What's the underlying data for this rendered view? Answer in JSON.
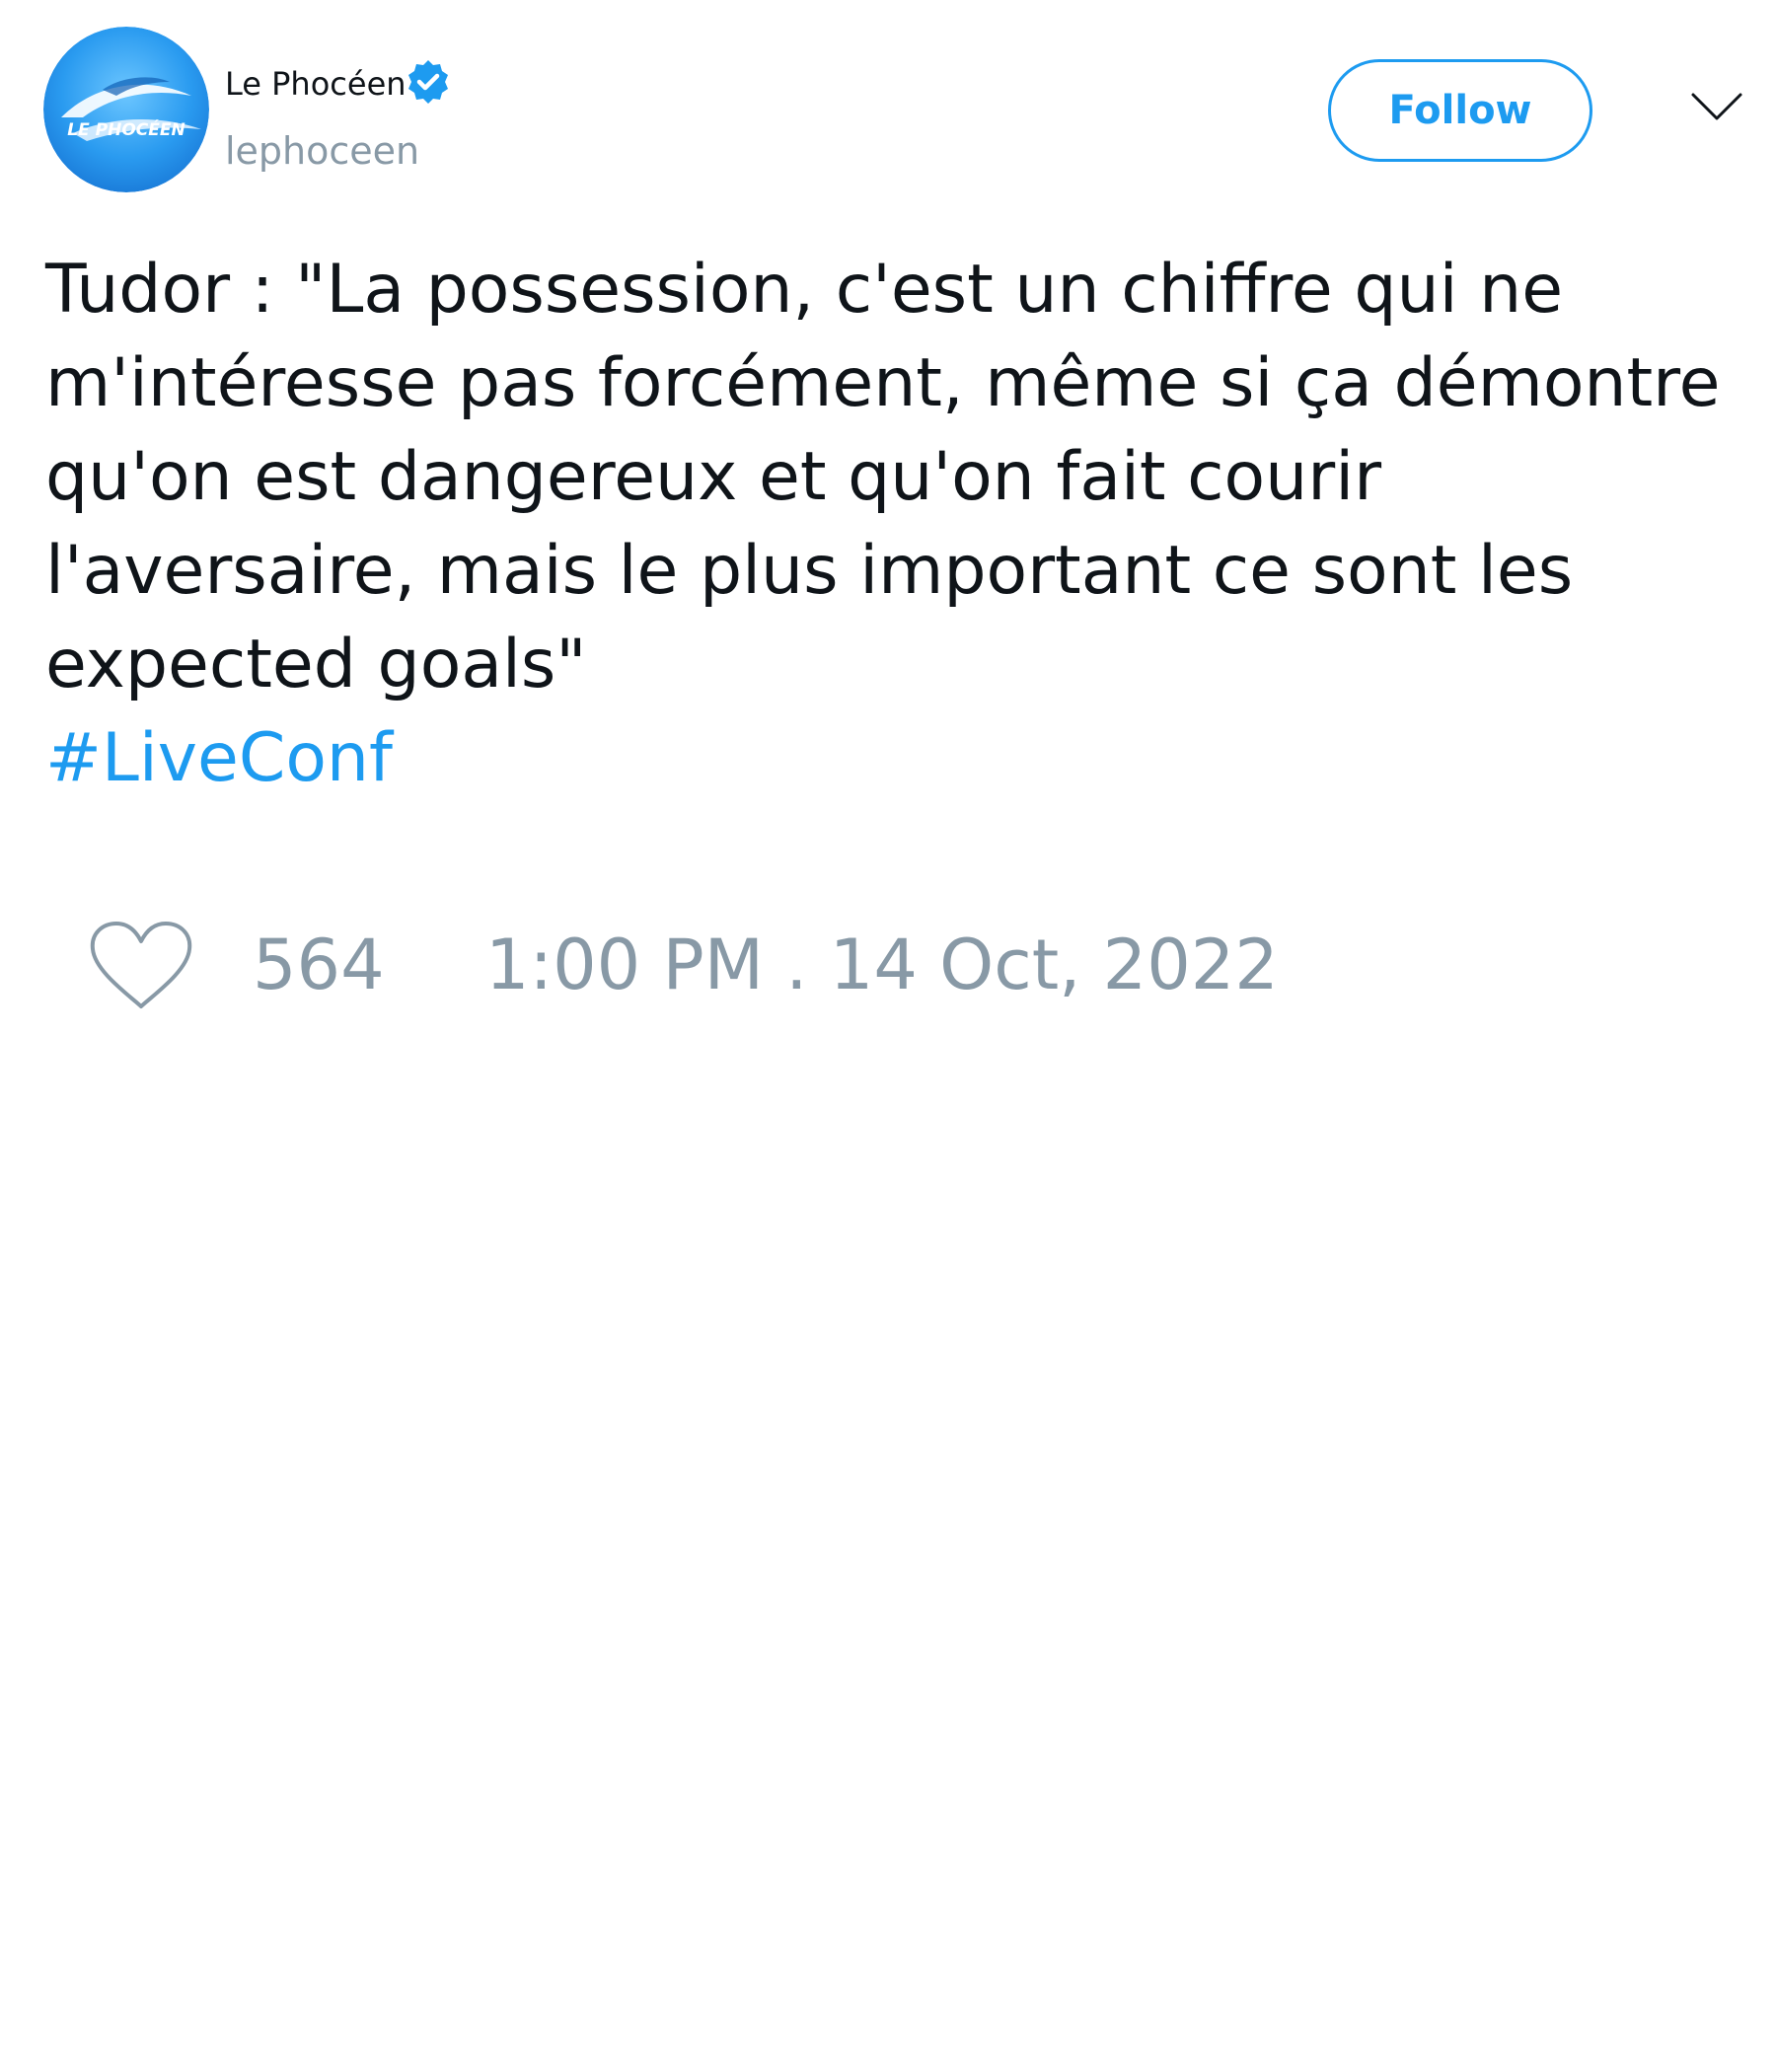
{
  "author": {
    "display_name": "Le Phocéen",
    "handle": "lephoceen",
    "avatar_logo_text": "LE PHOCÉEN",
    "verified_icon": "verified-badge-icon"
  },
  "header": {
    "follow_label": "Follow",
    "menu_icon": "chevron-down-icon"
  },
  "tweet": {
    "text": "Tudor : \"La possession, c'est un chiffre qui ne m'intéresse pas forcément, même si ça démontre qu'on est dangereux et qu'on fait courir l'aversaire, mais le plus important ce sont les expected goals\"",
    "hashtag": "#LiveConf"
  },
  "footer": {
    "like_icon": "heart-icon",
    "like_count": "564",
    "timestamp": "1:00 PM . 14 Oct, 2022"
  },
  "colors": {
    "accent": "#1d9bf0",
    "muted": "#8899a6",
    "text": "#0f1419"
  }
}
